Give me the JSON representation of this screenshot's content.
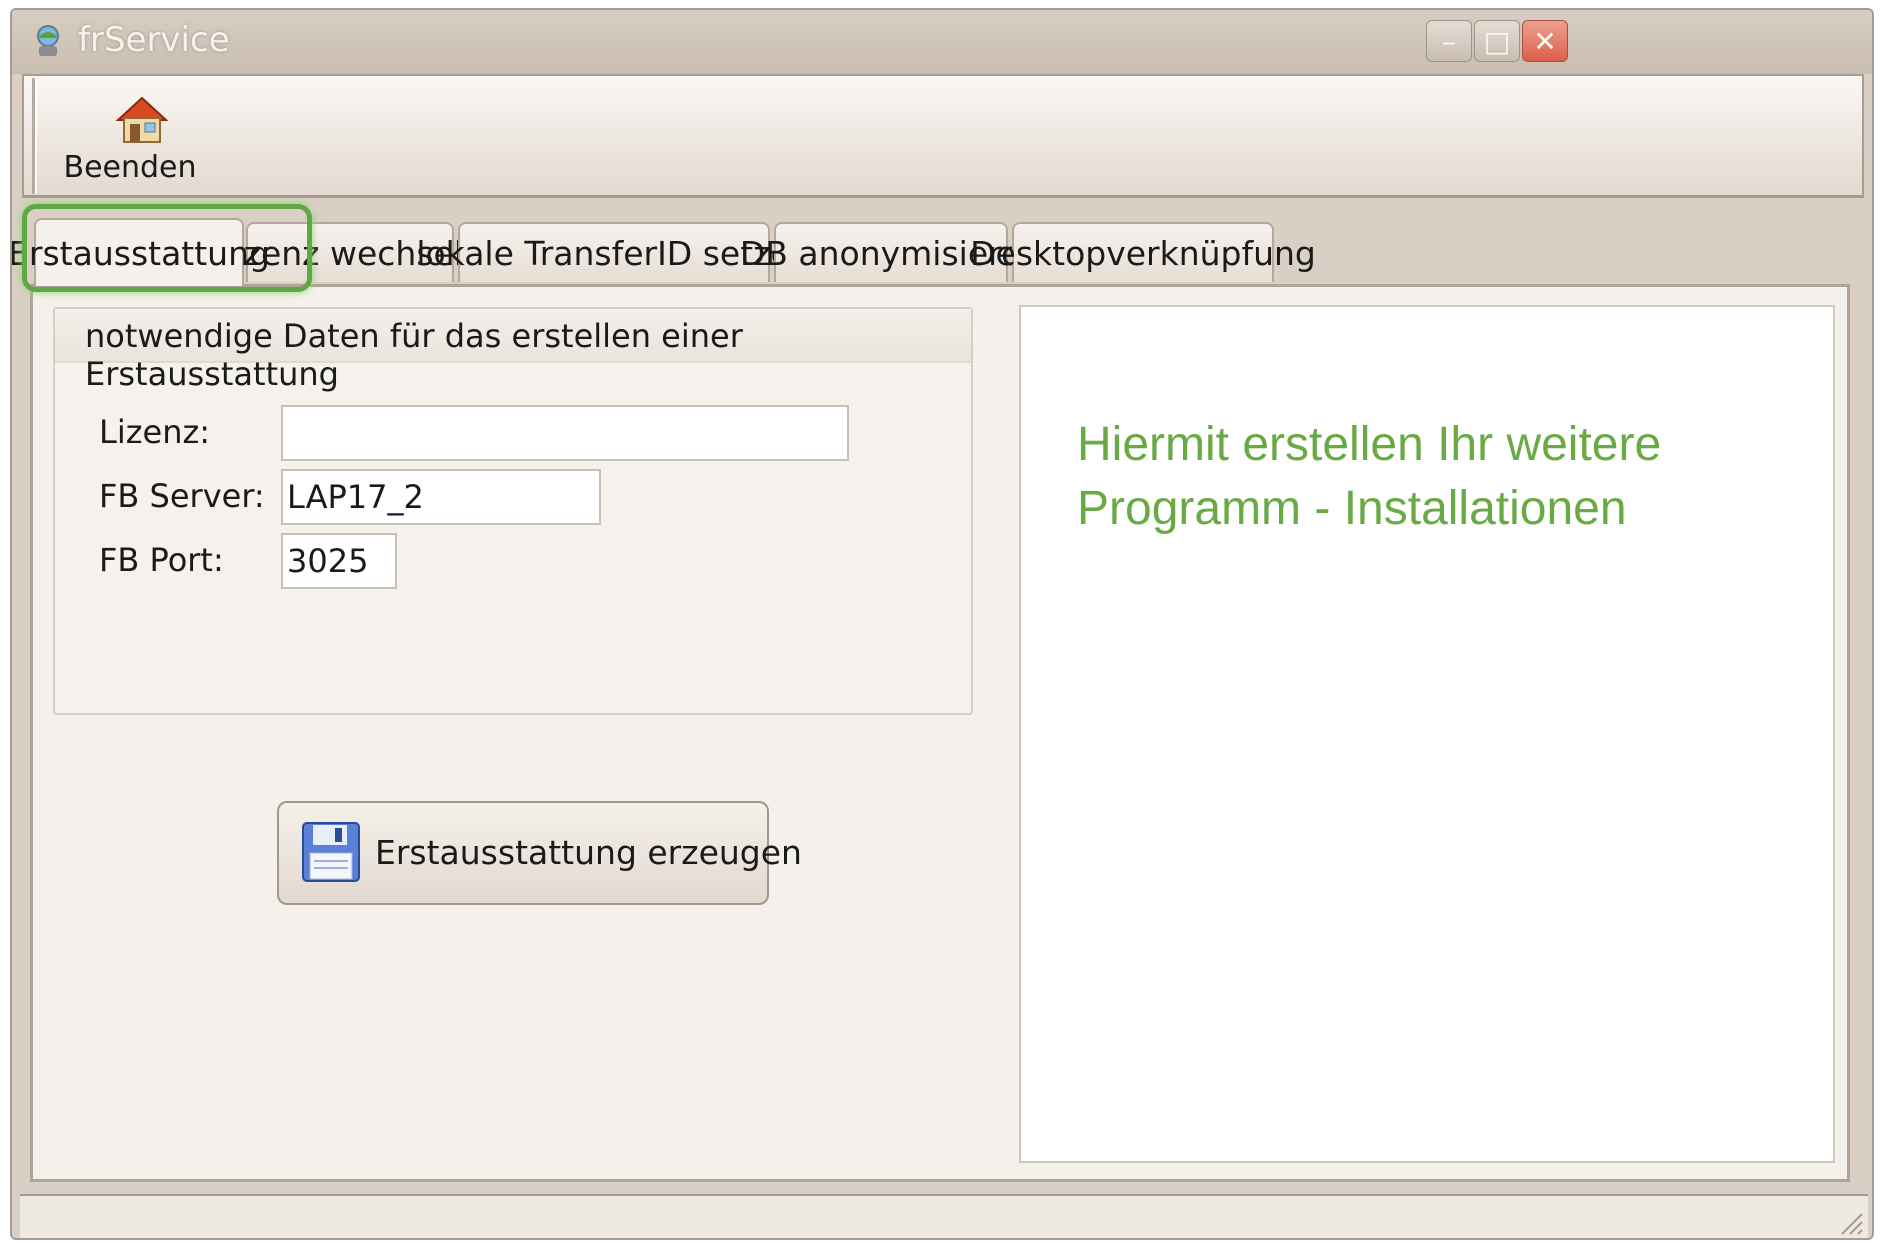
{
  "window": {
    "title": "frService",
    "controls": {
      "minimize": "–",
      "maximize": "□",
      "close": "✕"
    }
  },
  "toolbar": {
    "quit_label": "Beenden",
    "quit_icon": "home-icon"
  },
  "tabs": [
    {
      "label": "Erstausstattung",
      "active": true
    },
    {
      "label": "Lizenz wechseln",
      "active": false
    },
    {
      "label": "lokale TransferID setzen",
      "active": false
    },
    {
      "label": "DB anonymisieren",
      "active": false
    },
    {
      "label": "Desktopverknüpfung",
      "active": false
    }
  ],
  "group": {
    "title": "notwendige Daten für das erstellen einer Erstausstattung",
    "fields": [
      {
        "label": "Lizenz:",
        "value": ""
      },
      {
        "label": "FB Server:",
        "value": "LAP17_2"
      },
      {
        "label": "FB Port:",
        "value": "3025"
      }
    ]
  },
  "actions": {
    "create_label": "Erstausstattung erzeugen",
    "create_icon": "floppy-disk-icon"
  },
  "info": {
    "line1": "Hiermit erstellen Ihr weitere",
    "line2": "Programm - Installationen",
    "color": "#6aaa45"
  },
  "highlight_color": "#5fa844"
}
